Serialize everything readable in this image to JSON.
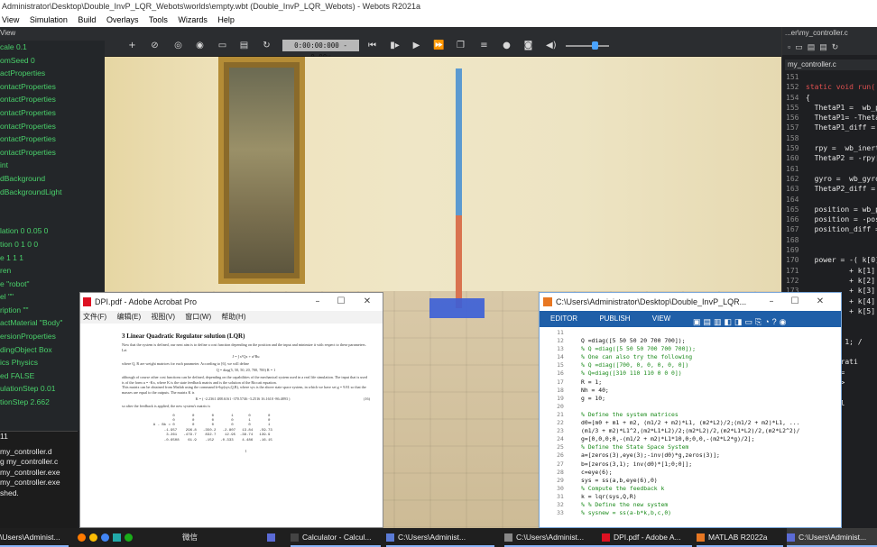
{
  "window": {
    "title": "Administrator\\Desktop\\Double_InvP_LQR_Webots\\worlds\\empty.wbt (Double_InvP_LQR_Webots) - Webots R2021a"
  },
  "menu": [
    "View",
    "Simulation",
    "Build",
    "Overlays",
    "Tools",
    "Wizards",
    "Help"
  ],
  "toolbar": {
    "view_label": "View",
    "time": "0:00:00:000 - 0.00x"
  },
  "scene_tree": [
    "cale 0.1",
    "omSeed 0",
    "actProperties",
    "ontactProperties",
    "ontactProperties",
    "ontactProperties",
    "ontactProperties",
    "ontactProperties",
    "ontactProperties",
    "int",
    "dBackground",
    "dBackgroundLight",
    "",
    "",
    "lation 0 0.05 0",
    "tion 0 1 0 0",
    "e 1 1 1",
    "ren",
    "e \"robot\"",
    "el \"\"",
    "ription \"\"",
    "actMaterial \"Body\"",
    "ersionProperties",
    "dingObject Box",
    "ics Physics",
    "ed FALSE",
    "ulationStep 0.01",
    "tionStep 2.662"
  ],
  "console": {
    "header": "11",
    "lines": [
      " my_controller.d",
      "g my_controller.c",
      "my_controller.exe",
      "my_controller.exe",
      "shed."
    ]
  },
  "editor": {
    "title": "...er\\my_controller.c",
    "tab": "my_controller.c",
    "lines": [
      {
        "n": "151",
        "t": ""
      },
      {
        "n": "152",
        "t": "",
        "kw": "static void run("
      },
      {
        "n": "154",
        "t": "{"
      },
      {
        "n": "155",
        "t": "  ThetaP1 =  wb_p"
      },
      {
        "n": "156",
        "t": "  ThetaP1= -Theta"
      },
      {
        "n": "157",
        "t": "  ThetaP1_diff ="
      },
      {
        "n": "158",
        "t": ""
      },
      {
        "n": "159",
        "t": "  rpy =  wb_inert"
      },
      {
        "n": "160",
        "t": "  ThetaP2 = -rpy["
      },
      {
        "n": "161",
        "t": ""
      },
      {
        "n": "162",
        "t": "  gyro =  wb_gyro"
      },
      {
        "n": "163",
        "t": "  ThetaP2_diff ="
      },
      {
        "n": "164",
        "t": ""
      },
      {
        "n": "165",
        "t": "  position = wb_p"
      },
      {
        "n": "166",
        "t": "  position = -pos"
      },
      {
        "n": "167",
        "t": "  position_diff ="
      },
      {
        "n": "168",
        "t": ""
      },
      {
        "n": "169",
        "t": ""
      },
      {
        "n": "170",
        "t": "  power = -( k[0]"
      },
      {
        "n": "171",
        "t": "          + k[1]"
      },
      {
        "n": "172",
        "t": "          + k[2]"
      },
      {
        "n": "173",
        "t": "          + k[3]"
      },
      {
        "n": "174",
        "t": "          + k[4]"
      },
      {
        "n": "175",
        "t": "          + k[5]"
      },
      {
        "n": "176",
        "t": "  );"
      },
      {
        "n": "177",
        "t": ""
      },
      {
        "n": "178",
        "t": "  // r = 1; /"
      },
      {
        "n": "179",
        "t": ""
      },
      {
        "n": "180",
        "t": "  //Saturati"
      },
      {
        "n": "181",
        "t": "  power ="
      },
      {
        "n": "182",
        "t": "  power >"
      },
      {
        "n": "183",
        "t": ""
      },
      {
        "n": "184",
        "t": "  Control"
      }
    ]
  },
  "pdf": {
    "title": "DPI.pdf - Adobe Acrobat Pro",
    "menu": [
      "文件(F)",
      "编辑(E)",
      "视图(V)",
      "窗口(W)",
      "帮助(H)"
    ],
    "section": "3    Linear Quadratic Regulator solution (LQR)",
    "p1": "Now that the system is defined, our next aim is to define a cost function depending on the position and the input and minimize it with respect to these parameters. Let",
    "eq1": "J = ∫ xᵀQx + uᵀRu",
    "p2": "where Q, R are weight matrices for each parameter. According to [6], we will define",
    "eq2": "Q = diag(5, 50, 50, 20, 700, 700)     R = 1",
    "p3": "although of course other cost functions can be defined, depending on the capabilities of the mechanical system used in a real life simulation. The input that is used is of the form u = -Kx, where K is the state feedback matrix and is the solution of the Riccati equation.",
    "p4": "This matrix can be obtained from Matlab using the command k=lqr(sys,Q,R), where sys is the above state space system, in which we have set g = 9.81 so that the masses are equal to the outputs. The matrix K is",
    "eq3": "K = ( -2.2361   488.6161   -370.5746   -3.2516   16.1610   -86.4893 )",
    "eqno1": "(16)",
    "p5": "so after the feedback is applied, the new system's matrix is",
    "matrix": "           0        0        0        1       0        0\n           0        0        0        0       1        0\n  A - Bk = 0        0        0        0       0        1\n       -1.957    296.8   -350.2   -2.807   13.84   -59.73\n        3.261   -479.7    832.7    12.95  -38.74   139.9\n       -0.6508    61.9    -152   -0.333    4.486   -16.15",
    "eqno2": "(17)",
    "page_no": "1"
  },
  "matlab": {
    "title": "C:\\Users\\Administrator\\Desktop\\Double_InvP_LQR...",
    "tabs": [
      "EDITOR",
      "PUBLISH",
      "VIEW"
    ],
    "lines": [
      {
        "n": "11",
        "t": ""
      },
      {
        "n": "12",
        "t": "Q =diag([5 50 50 20 700 700]);"
      },
      {
        "n": "13",
        "t": "% Q =diag([5 50 50 700 700 700]);",
        "c": true
      },
      {
        "n": "14",
        "t": "% One can also try the following",
        "c": true
      },
      {
        "n": "15",
        "t": "% Q =diag([700, 0, 0, 0, 0, 0])",
        "c": true
      },
      {
        "n": "16",
        "t": "% Q=diag([310 110 110 0 0 0])",
        "c": true
      },
      {
        "n": "17",
        "t": "R = 1;"
      },
      {
        "n": "18",
        "t": "Nh = 40;"
      },
      {
        "n": "19",
        "t": "g = 10;"
      },
      {
        "n": "20",
        "t": ""
      },
      {
        "n": "21",
        "t": "% Define the system matrices",
        "c": true
      },
      {
        "n": "22",
        "t": "d0=[m0 + m1 + m2, (m1/2 + m2)*L1, (m2*L2)/2;(m1/2 + m2)*L1, ..."
      },
      {
        "n": "23",
        "t": "(m1/3 + m2)*L1^2,(m2*L1*L2)/2;(m2*L2)/2,(m2*L1*L2)/2,(m2*L2^2)/"
      },
      {
        "n": "24",
        "t": "g=[0,0,0;0,-(m1/2 + m2)*L1*10,0;0,0,-(m2*L2*g)/2];"
      },
      {
        "n": "25",
        "t": "% Define the State Space System",
        "c": true
      },
      {
        "n": "26",
        "t": "a=[zeros(3),eye(3);-inv(d0)*g,zeros(3)];"
      },
      {
        "n": "27",
        "t": "b=[zeros(3,1); inv(d0)*[1;0;0]];"
      },
      {
        "n": "28",
        "t": "c=eye(6);"
      },
      {
        "n": "29",
        "t": "sys = ss(a,b,eye(6),0)"
      },
      {
        "n": "30",
        "t": "% Compute the feedback k",
        "c": true
      },
      {
        "n": "31",
        "t": "k = lqr(sys,Q,R)"
      },
      {
        "n": "32",
        "t": "% % Define the new system",
        "c": true
      },
      {
        "n": "33",
        "t": "% sysnew = ss(a-b*k,b,c,0)",
        "c": true
      }
    ]
  },
  "taskbar": {
    "items": [
      "\\Users\\Administ...",
      "微信",
      "Calculator - Calcul...",
      "C:\\Users\\Administ...",
      "C:\\Users\\Administ...",
      "DPI.pdf - Adobe A...",
      "MATLAB R2022a",
      "C:\\Users\\Administ..."
    ]
  },
  "colors": {
    "accent": "#4aa3ff",
    "scene_tree_text": "#49d06a",
    "matlab_ribbon": "#1f5fa8",
    "pole_top": "#5c9ad0",
    "pole_bottom": "#d9734f",
    "robot_base": "#3a5ed8"
  }
}
